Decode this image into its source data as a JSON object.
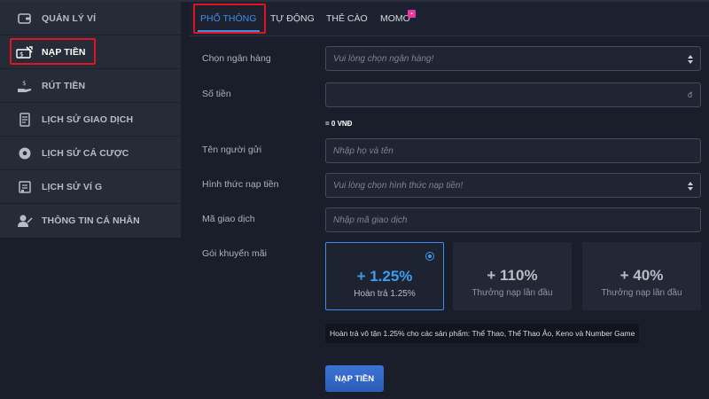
{
  "sidebar": {
    "items": [
      {
        "label": "QUẢN LÝ VÍ",
        "icon": "wallet-icon"
      },
      {
        "label": "NẠP TIỀN",
        "icon": "deposit-cash-icon"
      },
      {
        "label": "RÚT TIỀN",
        "icon": "withdraw-hand-icon"
      },
      {
        "label": "LỊCH SỬ GIAO DỊCH",
        "icon": "transaction-history-icon"
      },
      {
        "label": "LỊCH SỬ CÁ CƯỢC",
        "icon": "soccer-ball-icon"
      },
      {
        "label": "LỊCH SỬ VÍ G",
        "icon": "wallet-history-icon"
      },
      {
        "label": "THÔNG TIN CÁ NHÂN",
        "icon": "user-profile-icon"
      }
    ],
    "active_index": 1
  },
  "tabs": [
    {
      "label": "PHỔ THÔNG"
    },
    {
      "label": "TỰ ĐỘNG"
    },
    {
      "label": "THẺ CÀO"
    },
    {
      "label": "MOMO"
    }
  ],
  "tabs_active_index": 0,
  "form": {
    "bank_label": "Chọn ngân hàng",
    "bank_placeholder": "Vui lòng chọn ngân hàng!",
    "amount_label": "Số tiền",
    "amount_currency": "đ",
    "amount_converted": "= 0 VNĐ",
    "sender_label": "Tên người gửi",
    "sender_placeholder": "Nhập họ và tên",
    "method_label": "Hình thức nạp tiền",
    "method_placeholder": "Vui lòng chọn hình thức nạp tiền!",
    "transaction_label": "Mã giao dịch",
    "transaction_placeholder": "Nhập mã giao dịch",
    "promo_label": "Gói khuyến mãi"
  },
  "promotions": [
    {
      "value": "+ 1.25%",
      "subtitle": "Hoàn trả 1.25%",
      "selected": true
    },
    {
      "value": "+ 110%",
      "subtitle": "Thưởng nạp lần đầu",
      "selected": false
    },
    {
      "value": "+ 40%",
      "subtitle": "Thưởng nạp lần đầu",
      "selected": false
    }
  ],
  "tooltip": "Hoàn trả vô tận 1.25% cho các sản phẩm: Thể Thao, Thể Thao Ảo, Keno và Number Game",
  "submit_label": "NẠP TIỀN",
  "colors": {
    "background": "#1a1e2a",
    "sidebar": "#262b38",
    "accent_blue": "#3c8fe8",
    "highlight_red": "#e0141e",
    "momo_badge": "#e6399b"
  }
}
